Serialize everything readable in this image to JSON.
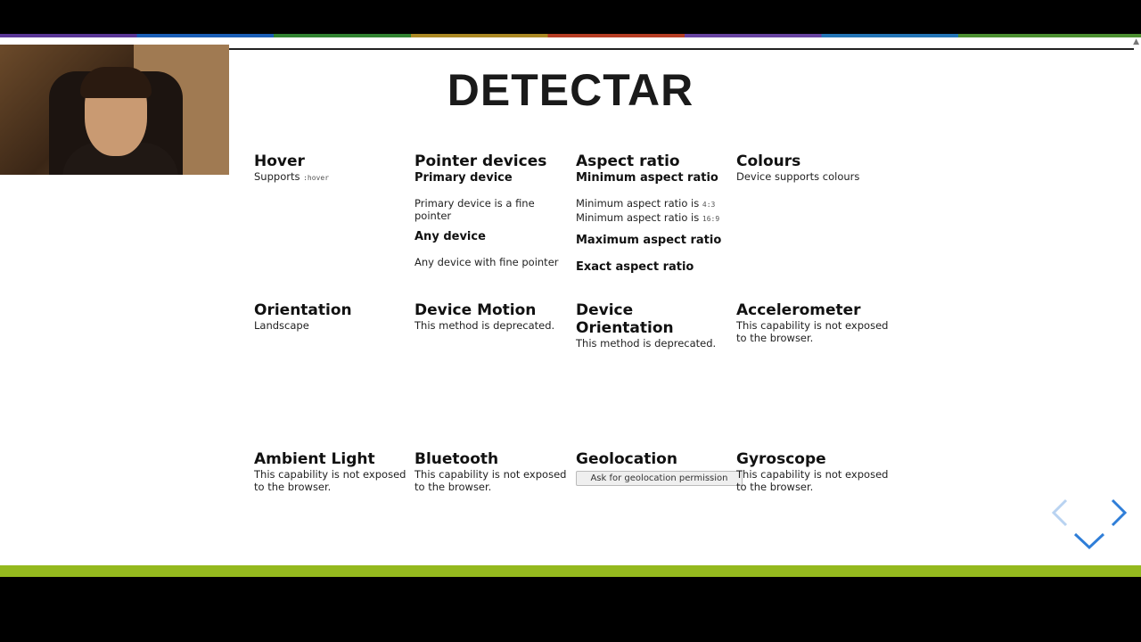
{
  "slide": {
    "title": "DETECTAR",
    "cells": {
      "hover": {
        "heading": "Hover",
        "text_prefix": "Supports ",
        "text_code": ":hover"
      },
      "pointer": {
        "heading": "Pointer devices",
        "primary_heading": "Primary device",
        "primary_text": "Primary device is a fine pointer",
        "any_heading": "Any device",
        "any_text": "Any device with fine pointer"
      },
      "aspect": {
        "heading": "Aspect ratio",
        "min_heading": "Minimum aspect ratio",
        "min_line1_prefix": "Minimum aspect ratio is ",
        "min_line1_code": "4:3",
        "min_line2_prefix": "Minimum aspect ratio is ",
        "min_line2_code": "16:9",
        "max_heading": "Maximum aspect ratio",
        "exact_heading": "Exact aspect ratio"
      },
      "colours": {
        "heading": "Colours",
        "text": "Device supports colours"
      },
      "orientation": {
        "heading": "Orientation",
        "text": "Landscape"
      },
      "device_motion": {
        "heading": "Device Motion",
        "text": "This method is deprecated."
      },
      "device_orientation": {
        "heading": "Device Orientation",
        "text": "This method is deprecated."
      },
      "accelerometer": {
        "heading": "Accelerometer",
        "text": "This capability is not exposed to the browser."
      },
      "ambient_light": {
        "heading": "Ambient Light",
        "text": "This capability is not exposed to the browser."
      },
      "bluetooth": {
        "heading": "Bluetooth",
        "text": "This capability is not exposed to the browser."
      },
      "geolocation": {
        "heading": "Geolocation",
        "button": "Ask for geolocation permission"
      },
      "gyroscope": {
        "heading": "Gyroscope",
        "text": "This capability is not exposed to the browser."
      }
    }
  },
  "navigation": {
    "prev_icon": "chevron-left-icon",
    "next_icon": "chevron-right-icon",
    "down_icon": "chevron-down-icon",
    "prev_enabled": false,
    "accent_color": "#2f7ed8"
  },
  "colors": {
    "footer_bar": "#94b91e"
  }
}
